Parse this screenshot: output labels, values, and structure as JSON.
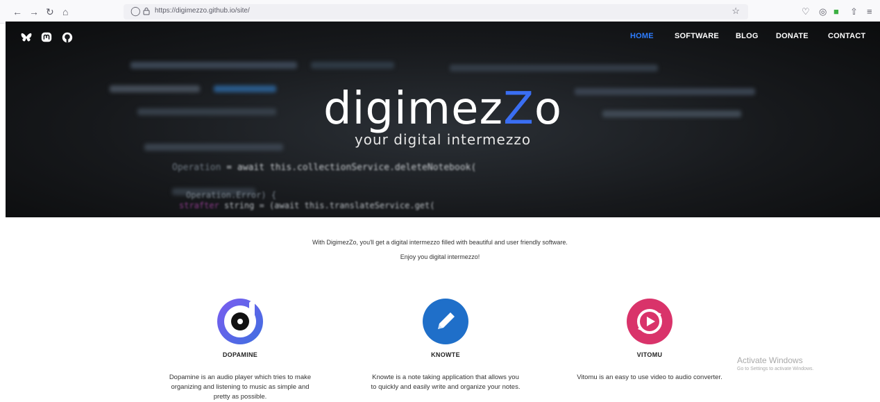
{
  "browser": {
    "url": "https://digimezzo.github.io/site/"
  },
  "site": {
    "logo_main_a": "digimez",
    "logo_main_b": "Z",
    "logo_main_c": "o",
    "tagline": "your digital intermezzo",
    "nav": [
      {
        "label": "HOME",
        "active": true
      },
      {
        "label": "SOFTWARE"
      },
      {
        "label": "BLOG"
      },
      {
        "label": "DONATE"
      },
      {
        "label": "CONTACT"
      }
    ],
    "social": [
      "bluesky-icon",
      "mastodon-icon",
      "github-icon"
    ],
    "hero_code": [
      "= await this.collectionService.deleteNotebook(",
      "Operation.Error) {",
      "string = (await this.translateService.get("
    ]
  },
  "intro": {
    "line1": "With DigimezZo, you'll get a digital intermezzo filled with beautiful and user friendly software.",
    "line2": "Enjoy you digital intermezzo!"
  },
  "products": [
    {
      "name": "DOPAMINE",
      "icon": "dopamine-icon",
      "desc": "Dopamine is an audio player which tries to make organizing and listening to music as simple and pretty as possible."
    },
    {
      "name": "KNOWTE",
      "icon": "pencil-icon",
      "desc": "Knowte is a note taking application that allows you to quickly and easily write and organize your notes."
    },
    {
      "name": "VITOMU",
      "icon": "vitomu-icon",
      "desc": "Vitomu is an easy to use video to audio converter."
    }
  ],
  "watermark": {
    "title": "Activate Windows",
    "subtitle": "Go to Settings to activate Windows."
  },
  "colors": {
    "accent_blue": "#2e7dff",
    "logo_z": "#3a6ef2",
    "dopamine_ring": "#6a5acd",
    "knowte": "#1f6fc9",
    "vitomu": "#d9336a"
  }
}
